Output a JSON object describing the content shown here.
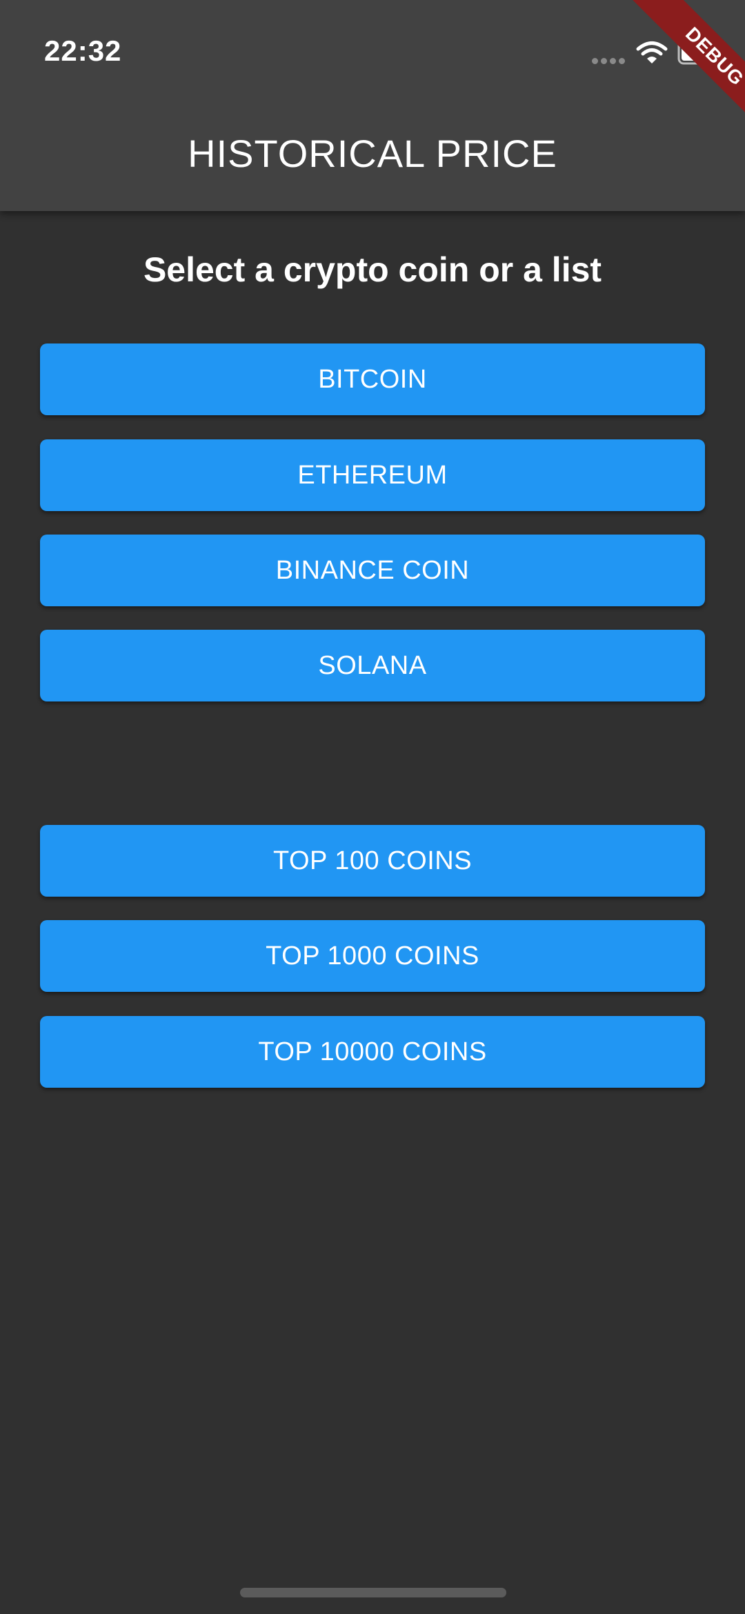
{
  "status_bar": {
    "time": "22:32",
    "icons": [
      "cellular-dots-icon",
      "wifi-icon",
      "battery-icon"
    ]
  },
  "debug_banner": {
    "label": "DEBUG",
    "color": "#8b1d1d"
  },
  "app_bar": {
    "title": "HISTORICAL PRICE",
    "background": "#424242"
  },
  "main": {
    "prompt": "Select a crypto coin or a list",
    "background": "#303030",
    "button_color": "#2196f3",
    "coin_buttons": [
      {
        "label": "BITCOIN"
      },
      {
        "label": "ETHEREUM"
      },
      {
        "label": "BINANCE COIN"
      },
      {
        "label": "SOLANA"
      }
    ],
    "list_buttons": [
      {
        "label": "TOP 100 COINS"
      },
      {
        "label": "TOP 1000 COINS"
      },
      {
        "label": "TOP 10000 COINS"
      }
    ]
  }
}
